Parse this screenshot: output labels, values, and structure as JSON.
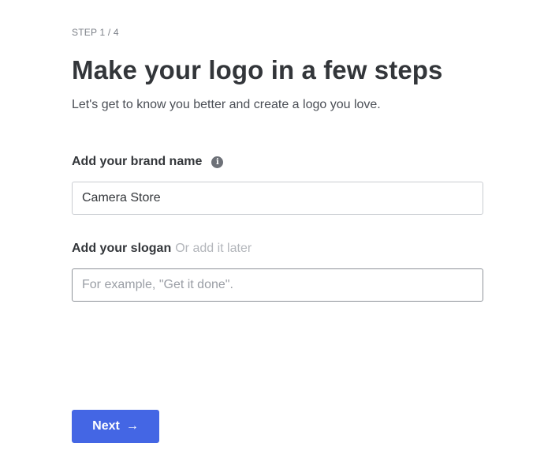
{
  "step": {
    "indicator": "STEP 1 / 4"
  },
  "header": {
    "title": "Make your logo in a few steps",
    "subtitle": "Let's get to know you better and create a logo you love."
  },
  "brand_name": {
    "label": "Add your brand name",
    "info_icon": "i",
    "value": "Camera Store"
  },
  "slogan": {
    "label": "Add your slogan",
    "hint": "Or add it later",
    "value": "",
    "placeholder": "For example, \"Get it done\"."
  },
  "actions": {
    "next_label": "Next",
    "next_arrow": "→"
  },
  "colors": {
    "primary": "#4466e4",
    "text": "#33363a",
    "muted": "#b3b6bb",
    "border": "#c9ccd1"
  }
}
